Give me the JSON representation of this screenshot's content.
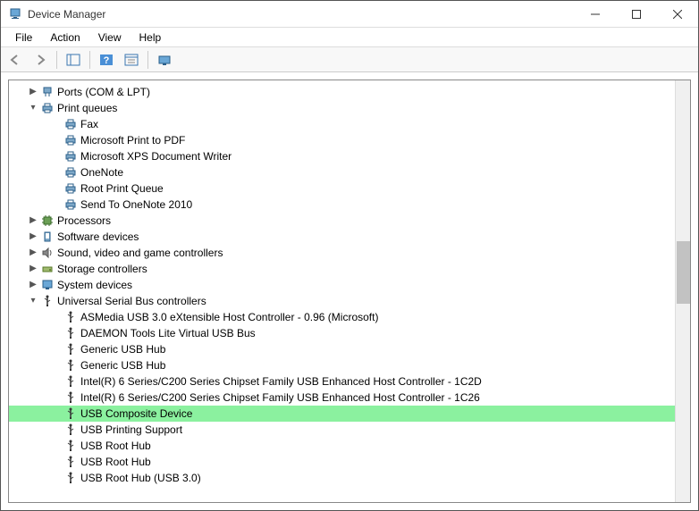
{
  "window": {
    "title": "Device Manager"
  },
  "menu": {
    "file": "File",
    "action": "Action",
    "view": "View",
    "help": "Help"
  },
  "tree": {
    "ports": {
      "label": "Ports (COM & LPT)",
      "expanded": false
    },
    "print_queues": {
      "label": "Print queues",
      "expanded": true,
      "items": [
        "Fax",
        "Microsoft Print to PDF",
        "Microsoft XPS Document Writer",
        "OneNote",
        "Root Print Queue",
        "Send To OneNote 2010"
      ]
    },
    "processors": {
      "label": "Processors",
      "expanded": false
    },
    "software_devices": {
      "label": "Software devices",
      "expanded": false
    },
    "sound": {
      "label": "Sound, video and game controllers",
      "expanded": false
    },
    "storage": {
      "label": "Storage controllers",
      "expanded": false
    },
    "system": {
      "label": "System devices",
      "expanded": false
    },
    "usb": {
      "label": "Universal Serial Bus controllers",
      "expanded": true,
      "items": [
        "ASMedia USB 3.0 eXtensible Host Controller - 0.96 (Microsoft)",
        "DAEMON Tools Lite Virtual USB Bus",
        "Generic USB Hub",
        "Generic USB Hub",
        "Intel(R) 6 Series/C200 Series Chipset Family USB Enhanced Host Controller - 1C2D",
        "Intel(R) 6 Series/C200 Series Chipset Family USB Enhanced Host Controller - 1C26",
        "USB Composite Device",
        "USB Printing Support",
        "USB Root Hub",
        "USB Root Hub",
        "USB Root Hub (USB 3.0)"
      ],
      "selected_index": 6
    }
  }
}
